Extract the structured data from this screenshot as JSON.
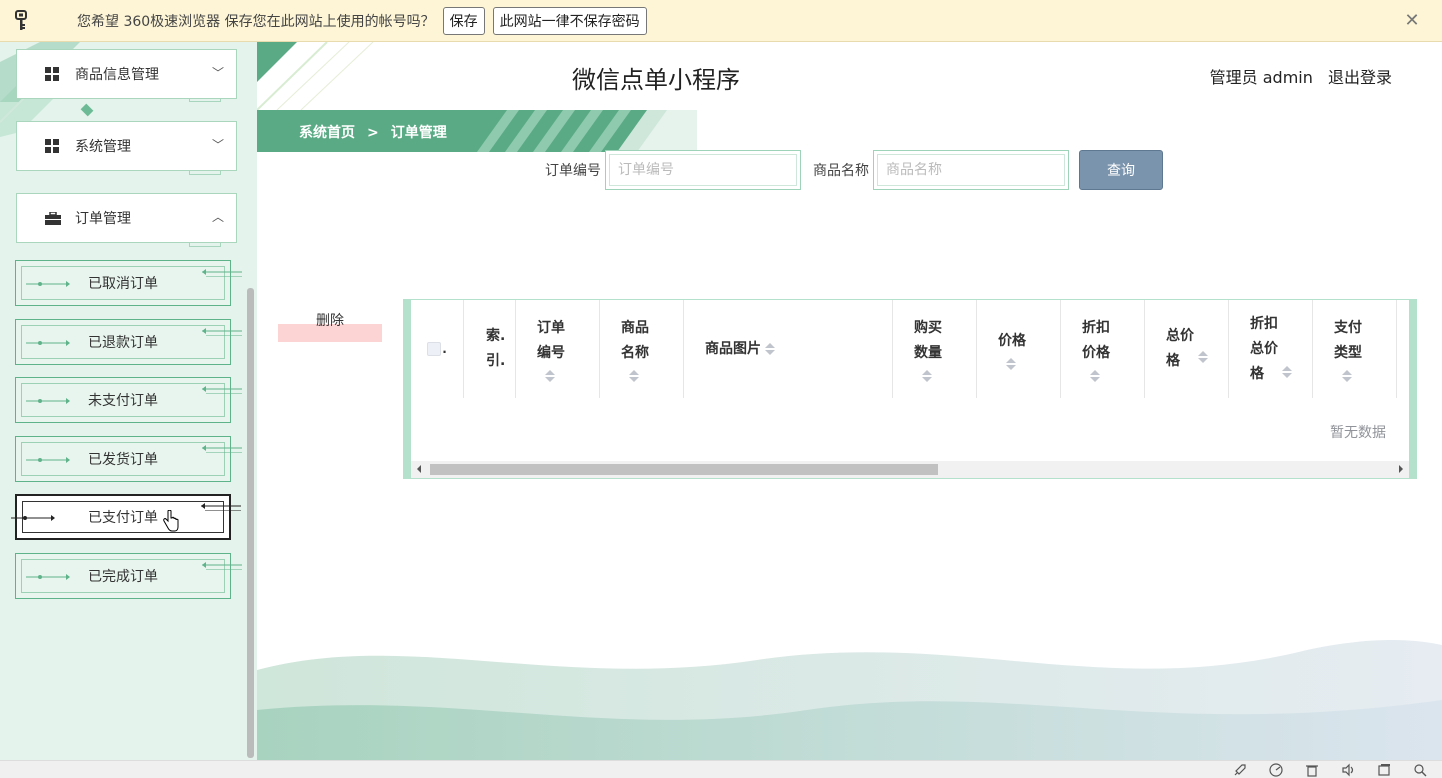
{
  "browser_bar": {
    "message": "您希望 360极速浏览器 保存您在此网站上使用的帐号吗？",
    "save_label": "保存",
    "never_label": "此网站一律不保存密码",
    "close_glyph": "✕"
  },
  "sidebar": {
    "menus": [
      {
        "label": "商品信息管理",
        "icon": "grid-icon",
        "chevron": "﹀"
      },
      {
        "label": "系统管理",
        "icon": "grid-icon",
        "chevron": "﹀"
      },
      {
        "label": "订单管理",
        "icon": "briefcase-icon",
        "chevron": "︿"
      }
    ],
    "sub_items": [
      {
        "label": "已取消订单"
      },
      {
        "label": "已退款订单"
      },
      {
        "label": "未支付订单"
      },
      {
        "label": "已发货订单"
      },
      {
        "label": "已支付订单",
        "active": true
      },
      {
        "label": "已完成订单"
      }
    ]
  },
  "header": {
    "title": "微信点单小程序",
    "user_label": "管理员 admin",
    "logout_label": "退出登录"
  },
  "breadcrumb": {
    "home": "系统首页",
    "separator": ">",
    "current": "订单管理"
  },
  "search": {
    "order_no_label": "订单编号",
    "order_no_placeholder": "订单编号",
    "order_no_value": "",
    "product_name_label": "商品名称",
    "product_name_placeholder": "商品名称",
    "product_name_value": "",
    "query_label": "查询"
  },
  "actions": {
    "delete_label": "删除"
  },
  "table": {
    "columns": [
      {
        "key": "select",
        "label": ""
      },
      {
        "key": "index",
        "label": "索.\n引."
      },
      {
        "key": "order_no",
        "label": "订单\n编号"
      },
      {
        "key": "product_name",
        "label": "商品\n名称"
      },
      {
        "key": "product_image",
        "label": "商品图片"
      },
      {
        "key": "quantity",
        "label": "购买\n数量"
      },
      {
        "key": "price",
        "label": "价格"
      },
      {
        "key": "discount_price",
        "label": "折扣\n价格"
      },
      {
        "key": "total_price",
        "label": "总价\n格"
      },
      {
        "key": "discount_total",
        "label": "折扣\n总价\n格"
      },
      {
        "key": "pay_type",
        "label": "支付\n类型"
      }
    ],
    "rows": [],
    "empty_text": "暂无数据"
  },
  "colors": {
    "accent_green": "#5aab85",
    "sidebar_bg": "#e4f3eb",
    "query_button": "#7b94ad",
    "delete_stripe": "#fcd4d4"
  }
}
